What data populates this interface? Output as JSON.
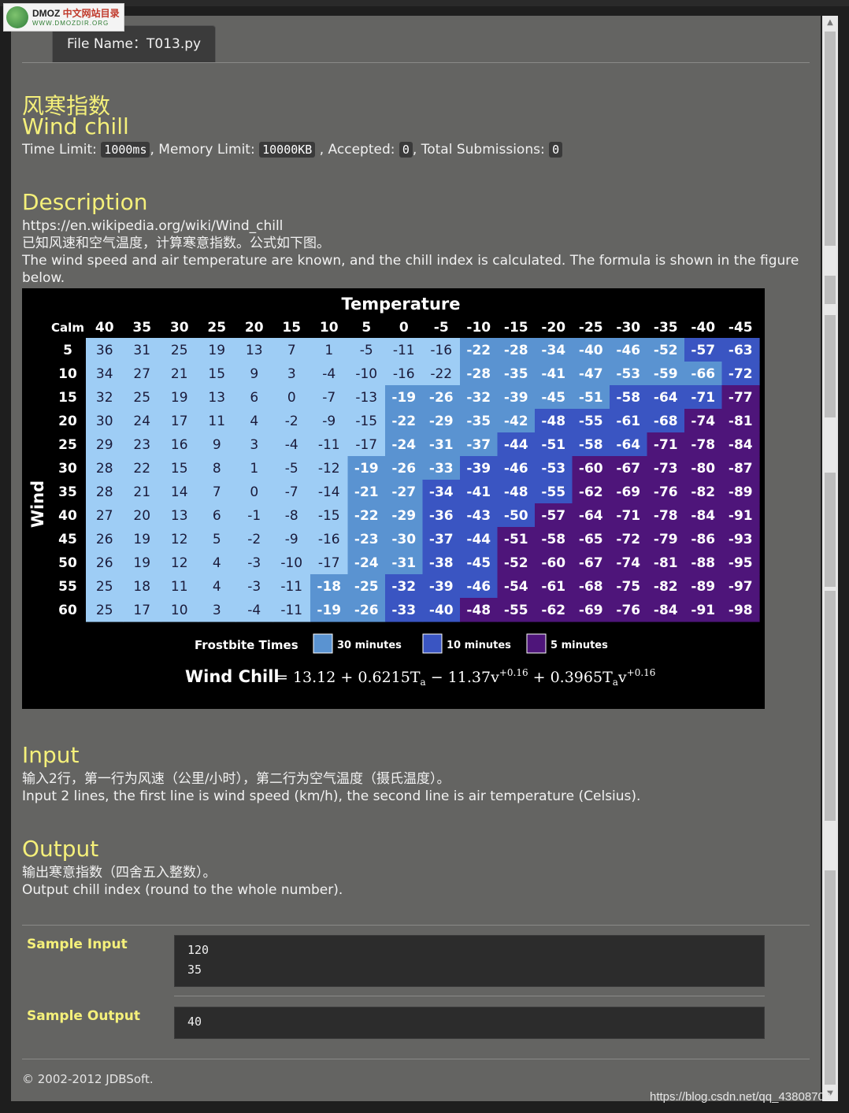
{
  "logo": {
    "brand": "DMOZ",
    "name_cn": "中文网站目录",
    "url": "WWW.DMOZDIR.ORG"
  },
  "file_tab": {
    "label": "File Name：T013.py"
  },
  "title": {
    "zh": "风寒指数",
    "en": "Wind chill"
  },
  "limits": {
    "time_label": "Time Limit:",
    "time": "1000ms",
    "memory_label": ", Memory Limit:",
    "memory": "10000KB",
    "accepted_label": ", Accepted:",
    "accepted": "0",
    "submissions_label": ", Total Submissions:",
    "submissions": "0"
  },
  "description": {
    "heading": "Description",
    "url": "https://en.wikipedia.org/wiki/Wind_chill",
    "zh": "已知风速和空气温度，计算寒意指数。公式如下图。",
    "en": "The wind speed and air temperature are known, and the chill index is calculated. The formula is shown in the figure below."
  },
  "chart_data": {
    "type": "table",
    "title": "Temperature",
    "corner_label": "Calm",
    "row_axis_label": "Wind",
    "temperatures": [
      "40",
      "35",
      "30",
      "25",
      "20",
      "15",
      "10",
      "5",
      "0",
      "-5",
      "-10",
      "-15",
      "-20",
      "-25",
      "-30",
      "-35",
      "-40",
      "-45"
    ],
    "winds": [
      "5",
      "10",
      "15",
      "20",
      "25",
      "30",
      "35",
      "40",
      "45",
      "50",
      "55",
      "60"
    ],
    "values": [
      [
        36,
        31,
        25,
        19,
        13,
        7,
        1,
        -5,
        -11,
        -16,
        -22,
        -28,
        -34,
        -40,
        -46,
        -52,
        -57,
        -63
      ],
      [
        34,
        27,
        21,
        15,
        9,
        3,
        -4,
        -10,
        -16,
        -22,
        -28,
        -35,
        -41,
        -47,
        -53,
        -59,
        -66,
        -72
      ],
      [
        32,
        25,
        19,
        13,
        6,
        0,
        -7,
        -13,
        -19,
        -26,
        -32,
        -39,
        -45,
        -51,
        -58,
        -64,
        -71,
        -77
      ],
      [
        30,
        24,
        17,
        11,
        4,
        -2,
        -9,
        -15,
        -22,
        -29,
        -35,
        -42,
        -48,
        -55,
        -61,
        -68,
        -74,
        -81
      ],
      [
        29,
        23,
        16,
        9,
        3,
        -4,
        -11,
        -17,
        -24,
        -31,
        -37,
        -44,
        -51,
        -58,
        -64,
        -71,
        -78,
        -84
      ],
      [
        28,
        22,
        15,
        8,
        1,
        -5,
        -12,
        -19,
        -26,
        -33,
        -39,
        -46,
        -53,
        -60,
        -67,
        -73,
        -80,
        -87
      ],
      [
        28,
        21,
        14,
        7,
        0,
        -7,
        -14,
        -21,
        -27,
        -34,
        -41,
        -48,
        -55,
        -62,
        -69,
        -76,
        -82,
        -89
      ],
      [
        27,
        20,
        13,
        6,
        -1,
        -8,
        -15,
        -22,
        -29,
        -36,
        -43,
        -50,
        -57,
        -64,
        -71,
        -78,
        -84,
        -91
      ],
      [
        26,
        19,
        12,
        5,
        -2,
        -9,
        -16,
        -23,
        -30,
        -37,
        -44,
        -51,
        -58,
        -65,
        -72,
        -79,
        -86,
        -93
      ],
      [
        26,
        19,
        12,
        4,
        -3,
        -10,
        -17,
        -24,
        -31,
        -38,
        -45,
        -52,
        -60,
        -67,
        -74,
        -81,
        -88,
        -95
      ],
      [
        25,
        18,
        11,
        4,
        -3,
        -11,
        -18,
        -25,
        -32,
        -39,
        -46,
        -54,
        -61,
        -68,
        -75,
        -82,
        -89,
        -97
      ],
      [
        25,
        17,
        10,
        3,
        -4,
        -11,
        -19,
        -26,
        -33,
        -40,
        -48,
        -55,
        -62,
        -69,
        -76,
        -84,
        -91,
        -98
      ]
    ],
    "zones": [
      [
        0,
        0,
        0,
        0,
        0,
        0,
        0,
        0,
        0,
        0,
        1,
        1,
        1,
        1,
        1,
        1,
        2,
        2
      ],
      [
        0,
        0,
        0,
        0,
        0,
        0,
        0,
        0,
        0,
        0,
        1,
        1,
        1,
        1,
        1,
        1,
        1,
        2
      ],
      [
        0,
        0,
        0,
        0,
        0,
        0,
        0,
        0,
        1,
        1,
        1,
        1,
        1,
        1,
        2,
        2,
        2,
        3
      ],
      [
        0,
        0,
        0,
        0,
        0,
        0,
        0,
        0,
        1,
        1,
        1,
        1,
        2,
        2,
        2,
        2,
        3,
        3
      ],
      [
        0,
        0,
        0,
        0,
        0,
        0,
        0,
        0,
        1,
        1,
        1,
        2,
        2,
        2,
        2,
        3,
        3,
        3
      ],
      [
        0,
        0,
        0,
        0,
        0,
        0,
        0,
        1,
        1,
        1,
        2,
        2,
        2,
        3,
        3,
        3,
        3,
        3
      ],
      [
        0,
        0,
        0,
        0,
        0,
        0,
        0,
        1,
        1,
        2,
        2,
        2,
        2,
        3,
        3,
        3,
        3,
        3
      ],
      [
        0,
        0,
        0,
        0,
        0,
        0,
        0,
        1,
        1,
        2,
        2,
        2,
        3,
        3,
        3,
        3,
        3,
        3
      ],
      [
        0,
        0,
        0,
        0,
        0,
        0,
        0,
        1,
        1,
        2,
        2,
        3,
        3,
        3,
        3,
        3,
        3,
        3
      ],
      [
        0,
        0,
        0,
        0,
        0,
        0,
        0,
        1,
        1,
        2,
        2,
        3,
        3,
        3,
        3,
        3,
        3,
        3
      ],
      [
        0,
        0,
        0,
        0,
        0,
        0,
        1,
        1,
        2,
        2,
        2,
        3,
        3,
        3,
        3,
        3,
        3,
        3
      ],
      [
        0,
        0,
        0,
        0,
        0,
        0,
        1,
        1,
        2,
        2,
        3,
        3,
        3,
        3,
        3,
        3,
        3,
        3
      ]
    ],
    "zone_colors": [
      "#9ecdf5",
      "#5a93d1",
      "#3a55c2",
      "#4e157a"
    ],
    "legend_title": "Frostbite Times",
    "legend": [
      {
        "label": "30 minutes",
        "color": "#5a93d1"
      },
      {
        "label": "10 minutes",
        "color": "#3a55c2"
      },
      {
        "label": "5 minutes",
        "color": "#4e157a"
      }
    ],
    "formula_label": "Wind Chill",
    "formula_parts": [
      "= 13.12 + 0.6215T",
      "a",
      " − 11.37v",
      "+0.16",
      " + 0.3965T",
      "a",
      "v",
      "+0.16"
    ]
  },
  "input": {
    "heading": "Input",
    "zh": "输入2行，第一行为风速（公里/小时），第二行为空气温度（摄氏温度）。",
    "en": "Input 2 lines, the first line is wind speed (km/h), the second line is air temperature (Celsius)."
  },
  "output": {
    "heading": "Output",
    "zh": "输出寒意指数（四舍五入整数）。",
    "en": "Output chill index (round to the whole number)."
  },
  "sample_input": {
    "label": "Sample Input",
    "line1": "120",
    "line2": "35"
  },
  "sample_output": {
    "label": "Sample Output",
    "value": "40"
  },
  "footer": {
    "text": "© 2002-2012  JDBSoft."
  },
  "watermark": {
    "text": "https://blog.csdn.net/qq_43808700"
  }
}
